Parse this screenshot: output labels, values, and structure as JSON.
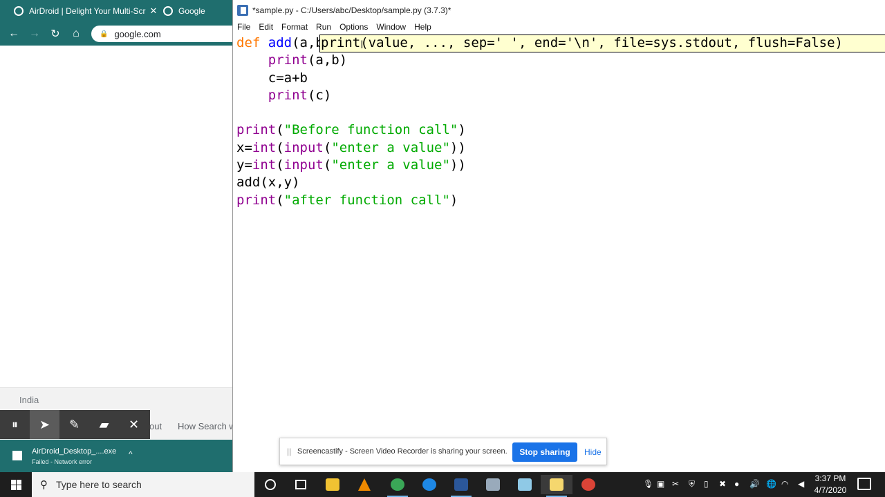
{
  "browser": {
    "tabs": [
      {
        "title": "AirDroid | Delight Your Multi-Scr",
        "close": "✕"
      },
      {
        "title": "Google"
      }
    ],
    "nav": {
      "back": "←",
      "forward": "→",
      "reload": "↻",
      "home": "⌂"
    },
    "address": "google.com",
    "footer_country": "India",
    "footer_links": [
      "out",
      "How Search w"
    ],
    "download": {
      "name": "AirDroid_Desktop_....exe",
      "status": "Failed - Network error",
      "chevron": "^"
    }
  },
  "annotation_tools": {
    "pause": "⏸",
    "cursor": "➤",
    "pen": "✎",
    "highlighter": "▰",
    "close": "✕"
  },
  "idle": {
    "title": "*sample.py - C:/Users/abc/Desktop/sample.py (3.7.3)*",
    "menus": [
      "File",
      "Edit",
      "Format",
      "Run",
      "Options",
      "Window",
      "Help"
    ],
    "code": {
      "l1_def": "def",
      "l1_name": " add",
      "l1_rest": "(a,b):",
      "l2_indent": "    ",
      "l2_print": "print",
      "l2_rest": "(a,b)",
      "l3": "    c=a+b",
      "l4_indent": "    ",
      "l4_print": "print",
      "l4_rest": "(c)",
      "l6_print": "print",
      "l6_open": "(",
      "l6_str": "\"Before function call\"",
      "l6_close": ")",
      "l7_pre": "x=",
      "l7_int": "int",
      "l7_mid": "(",
      "l7_input": "input",
      "l7_open": "(",
      "l7_str": "\"enter a value\"",
      "l7_close": "))",
      "l8_pre": "y=",
      "l8_int": "int",
      "l8_mid": "(",
      "l8_input": "input",
      "l8_open": "(",
      "l8_str": "\"enter a value\"",
      "l8_close": "))",
      "l9": "add(x,y)",
      "l10_print": "print",
      "l10_open": "(",
      "l10_str": "\"after function call\"",
      "l10_close": ")"
    },
    "calltip": "print(value, ..., sep=' ', end='\\n', file=sys.stdout, flush=False)",
    "ibeam": "I"
  },
  "screencastify": {
    "grip": "||",
    "message": "Screencastify - Screen Video Recorder is sharing your screen.",
    "stop": "Stop sharing",
    "hide": "Hide"
  },
  "taskbar": {
    "search_placeholder": "Type here to search",
    "time": "3:37 PM",
    "date": "4/7/2020"
  }
}
